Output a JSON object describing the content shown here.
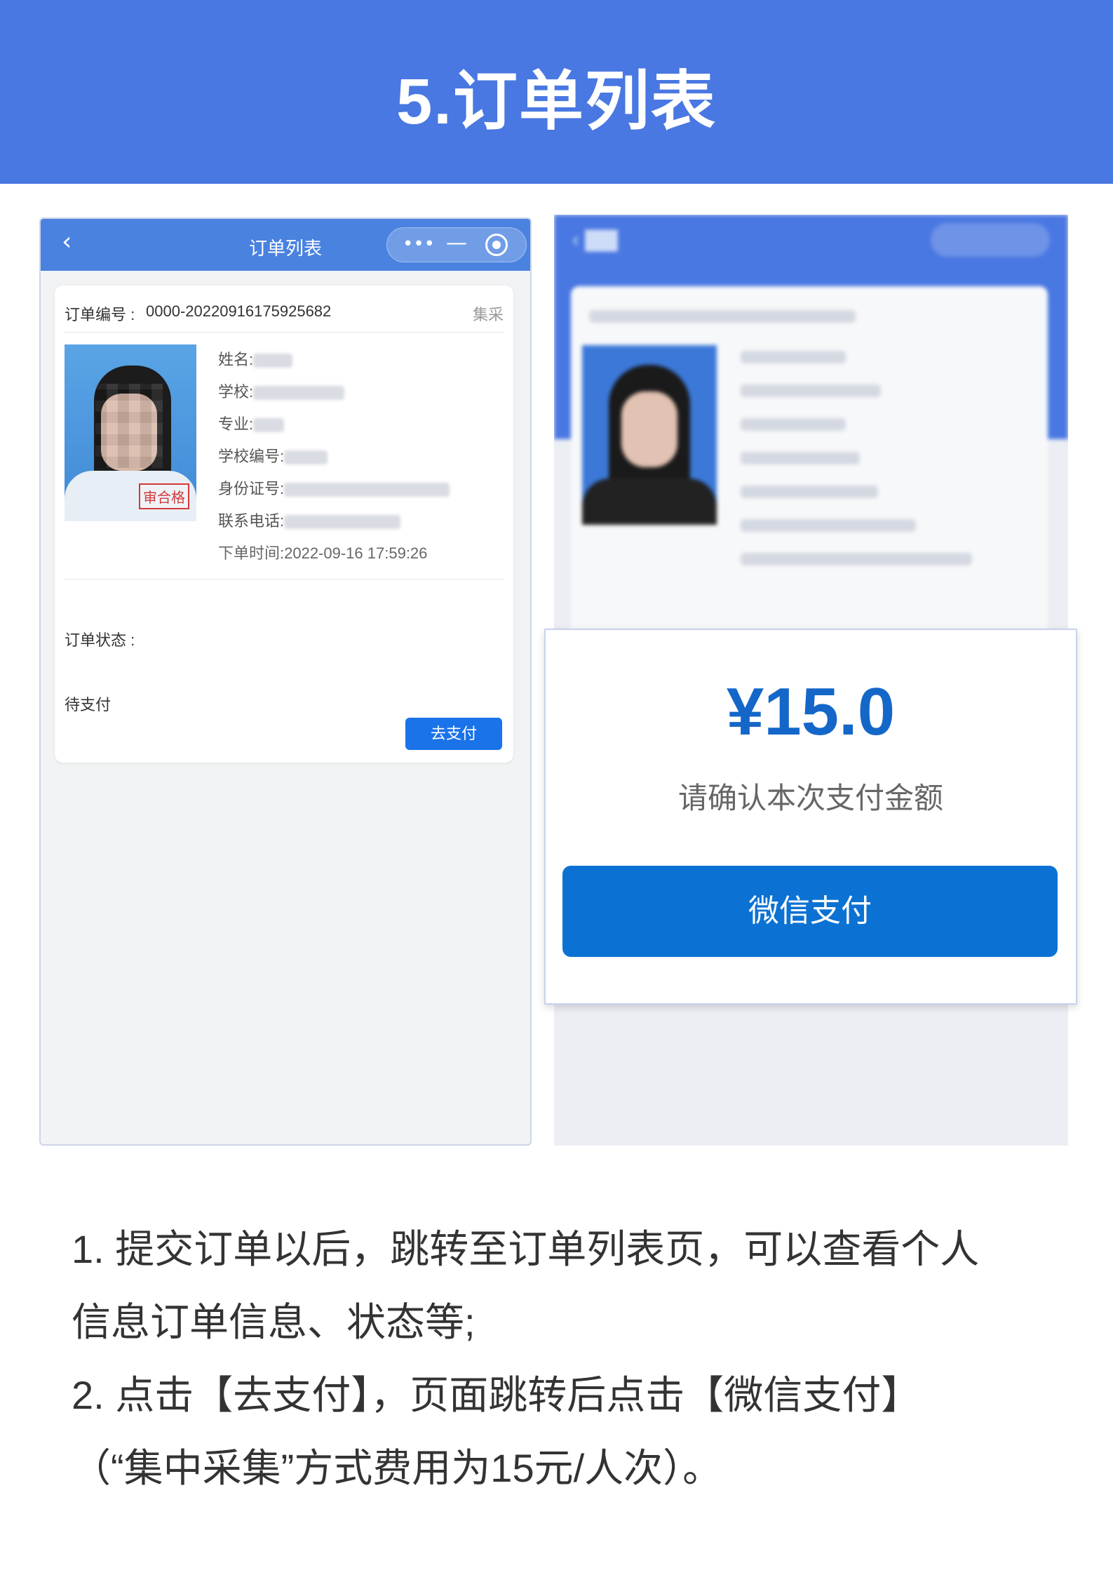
{
  "banner": {
    "title": "5.订单列表"
  },
  "order_list_screen": {
    "nav": {
      "back_icon": "‹",
      "title": "订单列表",
      "more_icon": "•••",
      "minimize_icon": "—"
    },
    "card": {
      "order_no_label": "订单编号 :",
      "order_no_value": "0000-20220916175925682",
      "order_type": "集采",
      "photo_stamp": "审合格",
      "fields": {
        "name": "姓名:",
        "school": "学校:",
        "major": "专业:",
        "school_code": "学校编号:",
        "id_number": "身份证号:",
        "phone": "联系电话:",
        "order_time": "下单时间:2022-09-16 17:59:26"
      },
      "status_label": "订单状态 :",
      "status_value": "待支付",
      "pay_button": "去支付"
    }
  },
  "payment_screen": {
    "amount": "¥15.0",
    "confirm_text": "请确认本次支付金额",
    "wechat_pay_button": "微信支付"
  },
  "instructions": {
    "line1": "1. 提交订单以后，跳转至订单列表页，可以查看个人",
    "line2": "信息订单信息、状态等;",
    "line3": "2. 点击【去支付】，页面跳转后点击【微信支付】",
    "line4": "（“集中采集”方式费用为15元/人次）。"
  }
}
